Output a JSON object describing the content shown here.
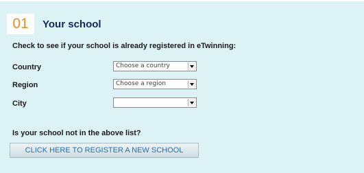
{
  "section": {
    "number": "01",
    "title": "Your school"
  },
  "instruction": "Check to see if your school is already registered in eTwinning:",
  "fields": [
    {
      "label": "Country",
      "value": "Choose a country"
    },
    {
      "label": "Region",
      "value": "Choose a region"
    },
    {
      "label": "City",
      "value": ""
    }
  ],
  "not_listed_question": "Is your school not in the above list?",
  "register_button_label": "CLICK HERE TO REGISTER A NEW SCHOOL",
  "colors": {
    "background": "#ddf2f4",
    "step_number": "#f28c1e",
    "title": "#112a55",
    "link": "#1c6fb7"
  },
  "icons": {
    "dropdown": "chevron-down-icon"
  }
}
